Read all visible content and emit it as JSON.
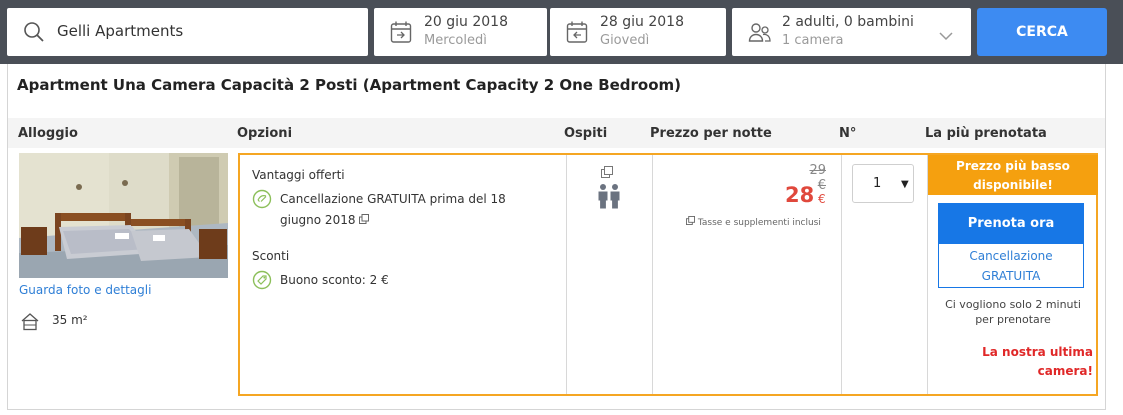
{
  "search": {
    "destination": "Gelli Apartments",
    "button_label": "CERCA"
  },
  "checkin": {
    "date": "20 giu 2018",
    "weekday": "Mercoledì"
  },
  "checkout": {
    "date": "28 giu 2018",
    "weekday": "Giovedì"
  },
  "guests": {
    "summary": "2 adulti, 0 bambini",
    "rooms": "1 camera"
  },
  "room": {
    "title": "Apartment Una Camera Capacità 2 Posti (Apartment Capacity 2 One Bedroom)",
    "photo_link": "Guarda foto e dettagli",
    "size": "35 m²"
  },
  "table_headers": {
    "alloggio": "Alloggio",
    "opzioni": "Opzioni",
    "ospiti": "Ospiti",
    "prezzo": "Prezzo per notte",
    "numero": "N°",
    "piu_prenotata": "La più prenotata"
  },
  "offer": {
    "benefits_title": "Vantaggi offerti",
    "cancellation_line1": "Cancellazione GRATUITA prima del 18",
    "cancellation_line2": "giugno 2018",
    "discounts_title": "Sconti",
    "voucher": "Buono sconto: 2 €",
    "old_price": "29 €",
    "price": "28",
    "currency": "€",
    "taxes_note": "Tasse e supplementi inclusi",
    "quantity": "1",
    "banner_line1": "Prezzo più basso",
    "banner_line2": "disponibile!",
    "book_button": "Prenota ora",
    "free_cancel_line1": "Cancellazione",
    "free_cancel_line2": "GRATUITA",
    "time_note_line1": "Ci vogliono solo 2 minuti",
    "time_note_line2": "per prenotare",
    "last_room_line1": "La nostra ultima",
    "last_room_line2": "camera!"
  },
  "icons": {
    "search": "search-icon",
    "calendar_in": "calendar-checkin-icon",
    "calendar_out": "calendar-checkout-icon",
    "guests": "guests-icon",
    "chevron": "chevron-down-icon",
    "house": "house-icon",
    "free_cancel": "free-cancellation-icon",
    "tag": "discount-tag-icon",
    "occupancy": "two-people-icon",
    "external": "external-link-icon"
  },
  "colors": {
    "top_bar": "#4a4f57",
    "search_button": "#3d8bf2",
    "offer_border": "#f5a623",
    "banner": "#f5a00f",
    "book_button": "#1777e6",
    "price": "#e0483c",
    "last_room": "#e02828",
    "link": "#2f7fd6"
  }
}
